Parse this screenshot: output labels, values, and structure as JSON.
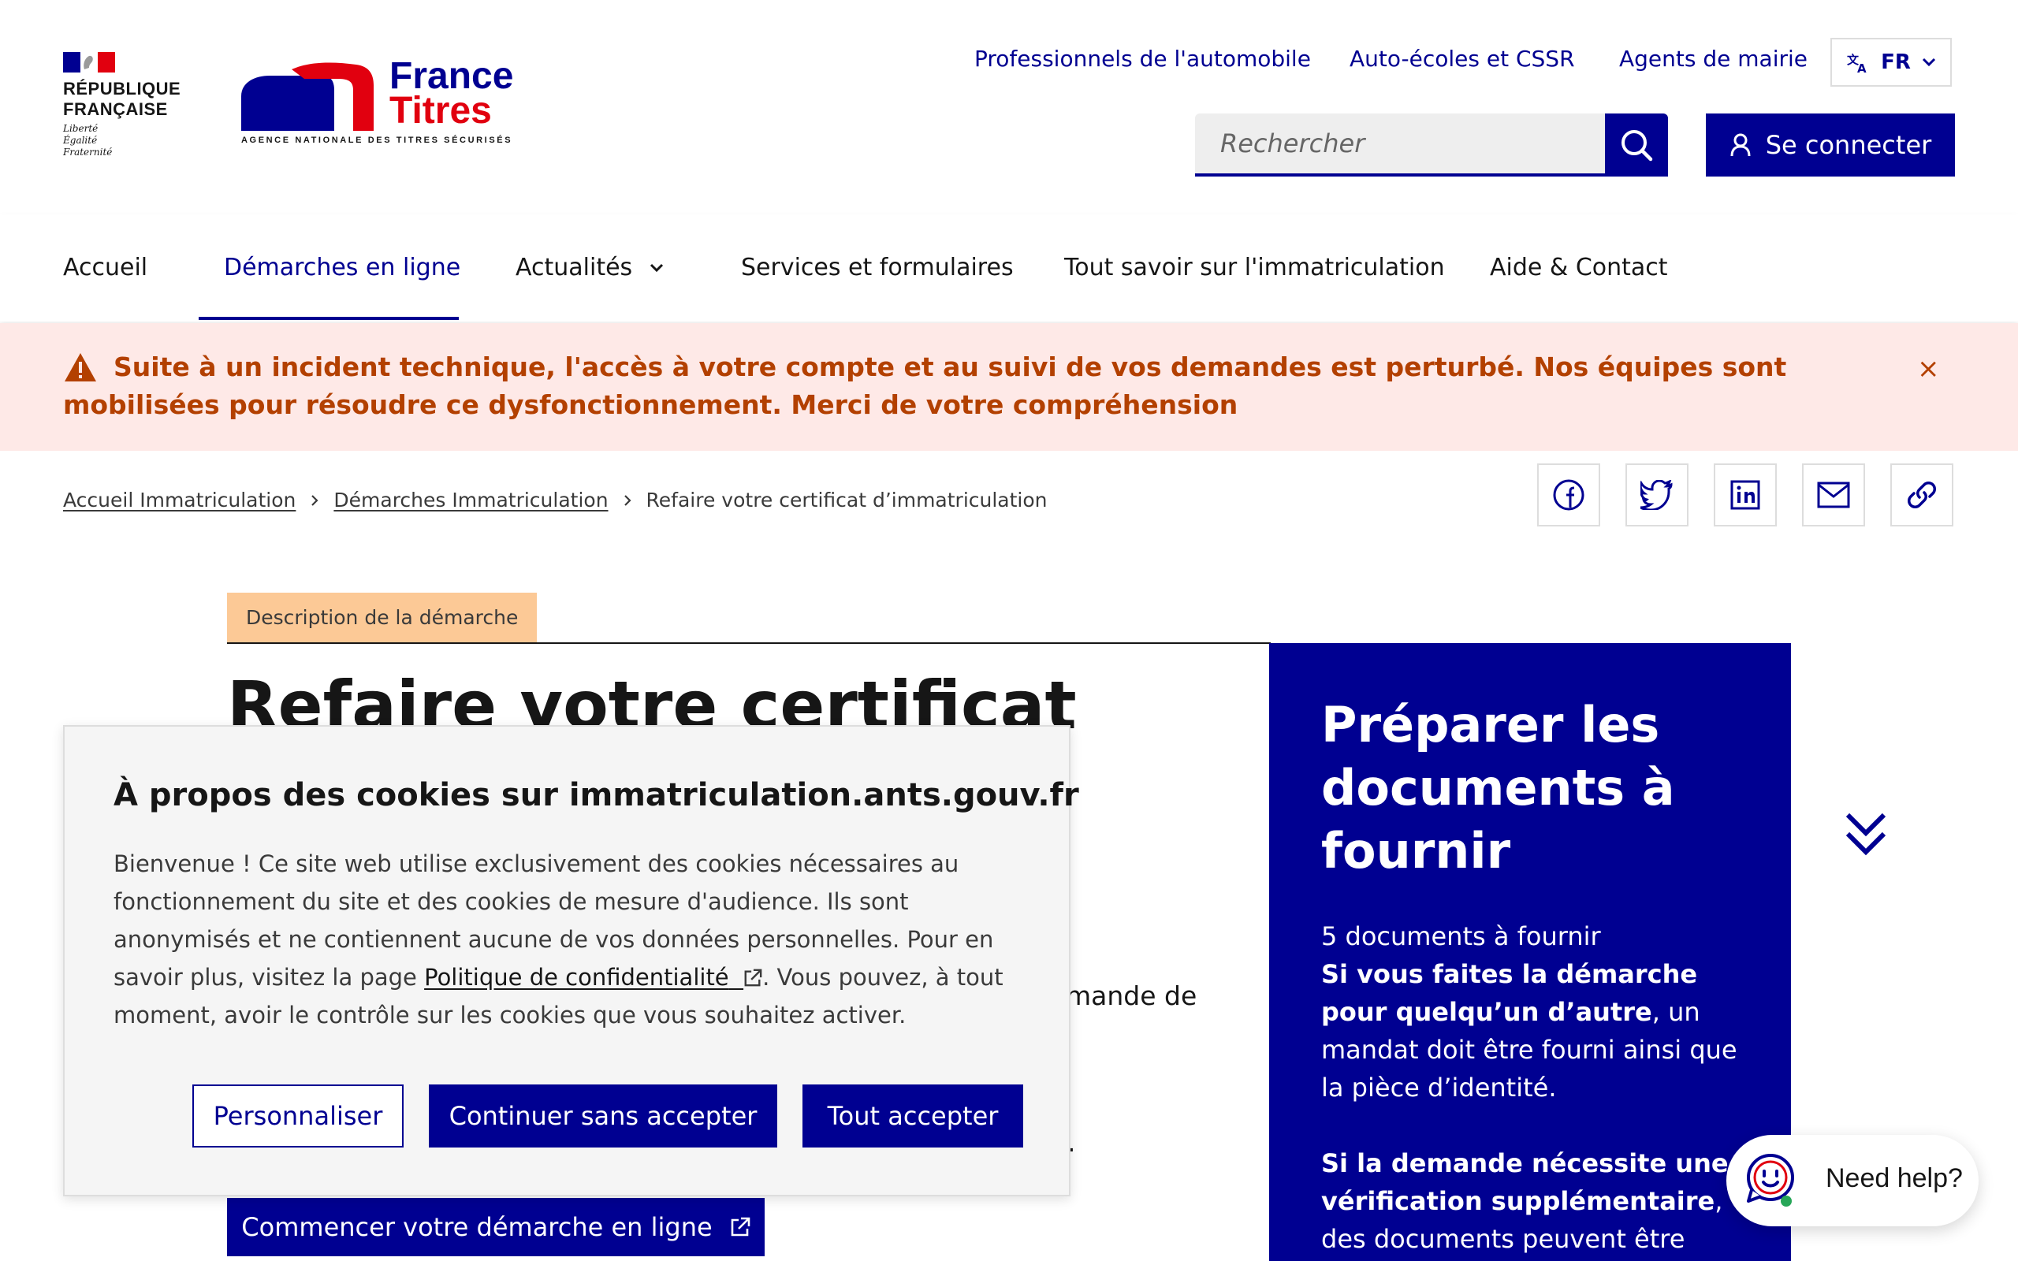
{
  "header": {
    "republic": {
      "line1": "RÉPUBLIQUE",
      "line2": "FRANÇAISE",
      "motto1": "Liberté",
      "motto2": "Égalité",
      "motto3": "Fraternité"
    },
    "brand": {
      "line1": "France",
      "line2": "Titres",
      "tagline": "AGENCE NATIONALE DES TITRES SÉCURISÉS"
    },
    "top_links": [
      "Professionnels de l'automobile",
      "Auto-écoles et CSSR",
      "Agents de mairie"
    ],
    "language": "FR",
    "search": {
      "placeholder": "Rechercher"
    },
    "login_label": "Se connecter"
  },
  "nav": {
    "items": [
      {
        "label": "Accueil"
      },
      {
        "label": "Démarches en ligne",
        "active": true
      },
      {
        "label": "Actualités"
      },
      {
        "label": "Services et formulaires"
      },
      {
        "label": "Tout savoir sur l'immatriculation"
      },
      {
        "label": "Aide & Contact"
      }
    ]
  },
  "alert": {
    "text": "Suite à un incident technique, l'accès à votre compte et au suivi de vos demandes est perturbé. Nos équipes sont mobilisées pour résoudre ce dysfonctionnement. Merci de votre compréhension",
    "close": "×"
  },
  "breadcrumb": {
    "items": [
      "Accueil Immatriculation",
      "Démarches Immatriculation"
    ],
    "current": "Refaire votre certificat d’immatriculation"
  },
  "share": [
    "facebook-icon",
    "twitter-icon",
    "linkedin-icon",
    "mail-icon",
    "link-icon"
  ],
  "main": {
    "tag": "Description de la démarche",
    "title": "Refaire votre certificat",
    "partial_text1": "mande de",
    "partial_text2": ".",
    "start_button": "Commencer votre démarche en ligne"
  },
  "side_panel": {
    "title": "Préparer les documents à fournir",
    "count": "5 documents à fournir",
    "bold1": "Si vous faites la démarche pour quelqu’un d’autre",
    "text1": ", un mandat doit être fourni ainsi que la pièce d’identité.",
    "bold2": "Si la demande nécessite une vérification supplémentaire",
    "text2": ", des documents peuvent être"
  },
  "cookie": {
    "title": "À propos des cookies sur immatriculation.ants.gouv.fr",
    "text_before": "Bienvenue ! Ce site web utilise exclusivement des cookies nécessaires au fonctionnement du site et des cookies de mesure d'audience. Ils sont anonymisés et ne contiennent aucune de vos données personnelles. Pour en savoir plus, visitez la page ",
    "policy_link": "Politique de confidentialité",
    "text_after": ". Vous pouvez, à tout moment, avoir le contrôle sur les cookies que vous souhaitez activer.",
    "buttons": {
      "customize": "Personnaliser",
      "continue": "Continuer sans accepter",
      "accept": "Tout accepter"
    }
  },
  "help": {
    "label": "Need help?"
  },
  "colors": {
    "primary": "#000091",
    "alert_bg": "#fee9e7",
    "alert_text": "#b34000",
    "tag_bg": "#fcc996",
    "red": "#e1000f"
  }
}
